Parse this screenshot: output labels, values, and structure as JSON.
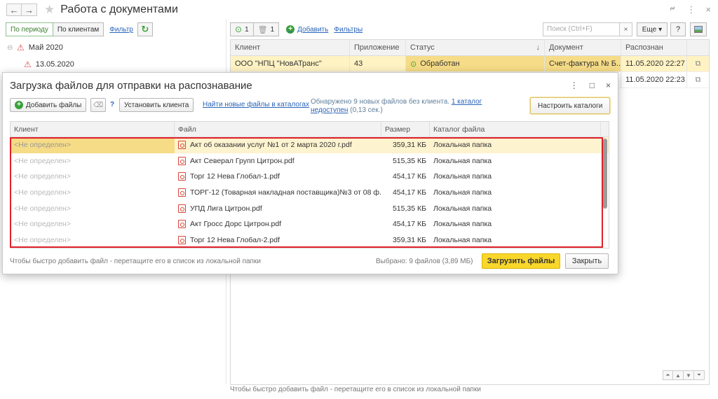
{
  "window": {
    "title": "Работа с документами",
    "back_icon": "←",
    "forward_icon": "→",
    "star_icon": "★",
    "link_icon": "🔗",
    "menu_icon": "⋮",
    "close_icon": "×"
  },
  "left": {
    "by_period": "По периоду",
    "by_clients": "По клиентам",
    "filter": "Фильтр",
    "refresh_icon": "↻",
    "tree": [
      {
        "label": "Май 2020",
        "expander": "⊖"
      },
      {
        "label": "13.05.2020",
        "expander": ""
      }
    ]
  },
  "right": {
    "count_ok": "1",
    "count_deleted": "1",
    "add": "Добавить",
    "filters": "Фильтры",
    "search_placeholder": "Поиск (Ctrl+F)",
    "search_clear": "×",
    "more": "Еще",
    "help": "?",
    "columns": {
      "client": "Клиент",
      "app": "Приложение",
      "status": "Статус",
      "sort_arrow": "↓",
      "document": "Документ",
      "recognized": "Распознан"
    },
    "rows": [
      {
        "client": "ООО \"НПЦ \"НовАТранс\"",
        "app": "43",
        "status": "Обработан",
        "document": "Счет-фактура № Б...",
        "recognized": "11.05.2020 22:27",
        "open": "⧉"
      },
      {
        "client": "",
        "app": "",
        "status": "",
        "document": "",
        "recognized": "11.05.2020 22:23",
        "open": "⧉"
      }
    ],
    "bottom_hint": "Чтобы быстро добавить файл - перетащите его в список из локальной папки"
  },
  "modal": {
    "title": "Загрузка файлов для отправки на распознавание",
    "add_files": "Добавить файлы",
    "help_q": "?",
    "set_client": "Установить клиента",
    "find_new": "Найти новые файлы в каталогах",
    "info_text": "Обнаружено 9 новых файлов без клиента.",
    "info_link1": "1 каталог",
    "info_link2": "недоступен",
    "info_time": "(0,13 сек.)",
    "configure": "Настроить каталоги",
    "columns": {
      "client": "Клиент",
      "file": "Файл",
      "size": "Размер",
      "catalog": "Каталог файла"
    },
    "files": [
      {
        "client": "<Не определен>",
        "file": "Акт об оказании услуг №1 от 2 марта 2020 г.pdf",
        "size": "359,31 КБ",
        "catalog": "Локальная папка"
      },
      {
        "client": "<Не определен>",
        "file": "Акт Северал Групп Цитрон.pdf",
        "size": "515,35 КБ",
        "catalog": "Локальная папка"
      },
      {
        "client": "<Не определен>",
        "file": "Торг 12 Нева Глобал-1.pdf",
        "size": "454,17 КБ",
        "catalog": "Локальная папка"
      },
      {
        "client": "<Не определен>",
        "file": "ТОРГ-12 (Товарная накладная поставщика)№3 от 08 ф...",
        "size": "454,17 КБ",
        "catalog": "Локальная папка"
      },
      {
        "client": "<Не определен>",
        "file": "УПД Лига Цитрон.pdf",
        "size": "515,35 КБ",
        "catalog": "Локальная папка"
      },
      {
        "client": "<Не определен>",
        "file": "Акт Гросс Дорс Цитрон.pdf",
        "size": "454,17 КБ",
        "catalog": "Локальная папка"
      },
      {
        "client": "<Не определен>",
        "file": "Торг 12 Нева Глобал-2.pdf",
        "size": "359,31 КБ",
        "catalog": "Локальная папка"
      }
    ],
    "footer_hint": "Чтобы быстро добавить файл - перетащите его в список из локальной папки",
    "selected": "Выбрано: 9 файлов (3,89 МБ)",
    "load": "Загрузить файлы",
    "close": "Закрыть"
  }
}
